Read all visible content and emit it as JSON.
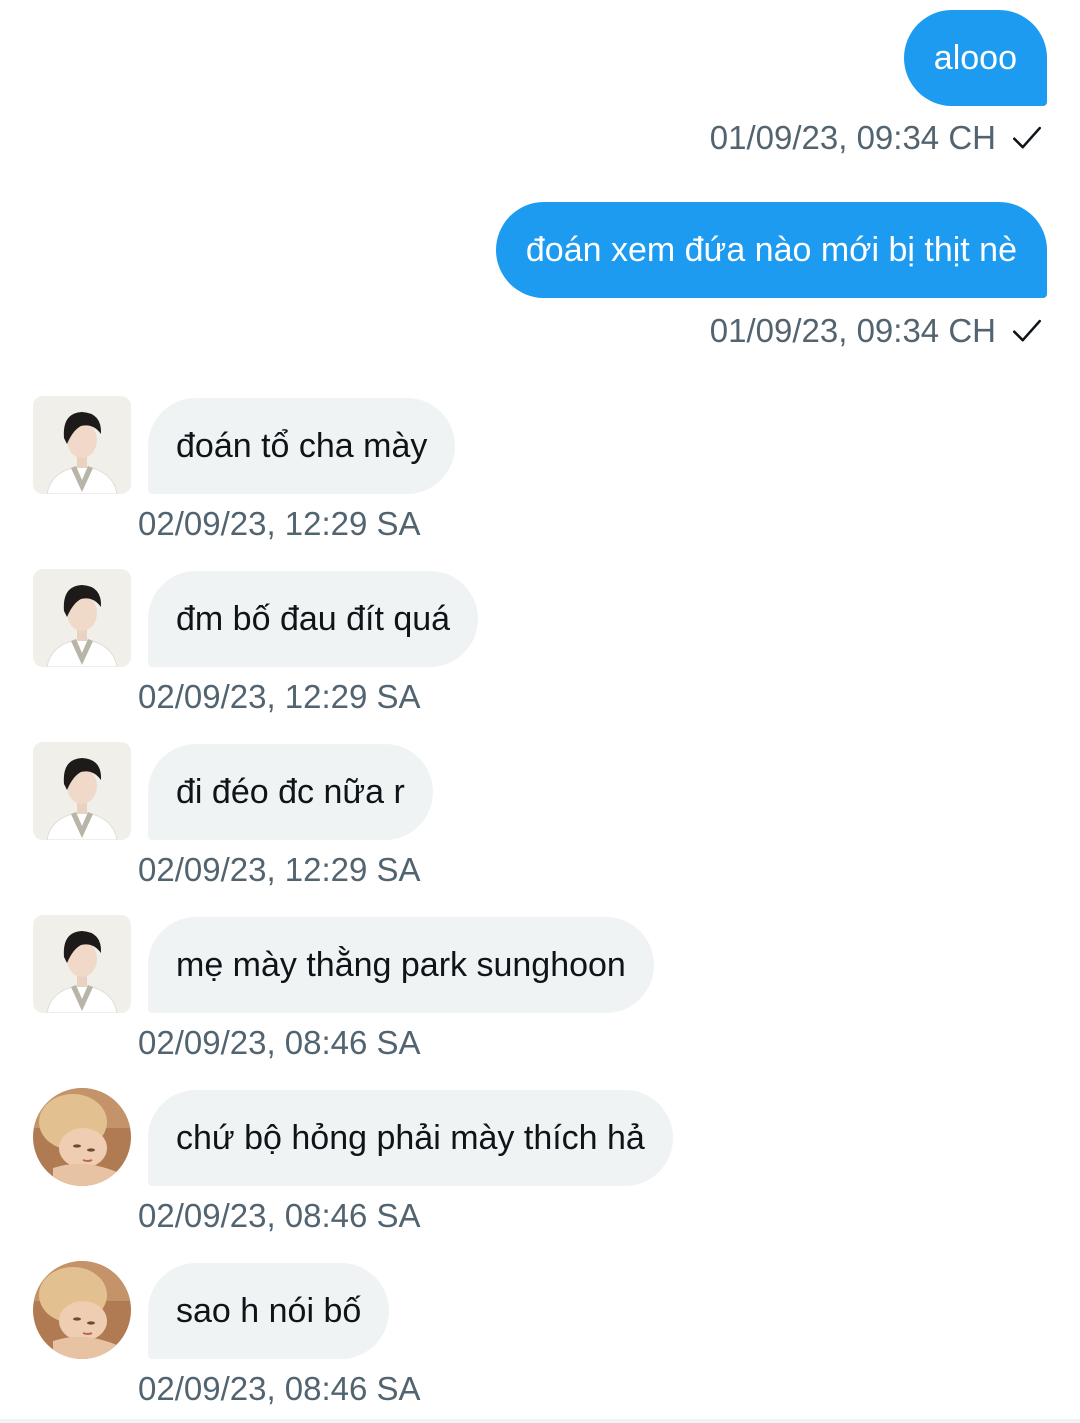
{
  "colors": {
    "sent_bubble": "#1d9bf0",
    "received_bubble": "#eff3f4",
    "timestamp": "#536471"
  },
  "sent_messages": [
    {
      "text": "alooo",
      "time": "01/09/23, 09:34 CH",
      "status_icon": "check-icon"
    },
    {
      "text": "đoán xem đứa nào mới bị thịt nè",
      "time": "01/09/23, 09:34 CH",
      "status_icon": "check-icon"
    }
  ],
  "received_messages": [
    {
      "avatar": "avatar-male-square",
      "text": "đoán tổ cha mày",
      "time": "02/09/23, 12:29 SA"
    },
    {
      "avatar": "avatar-male-square",
      "text": "đm bố đau đít quá",
      "time": "02/09/23, 12:29 SA"
    },
    {
      "avatar": "avatar-male-square",
      "text": "đi đéo đc nữa r",
      "time": "02/09/23, 12:29 SA"
    },
    {
      "avatar": "avatar-male-square",
      "text": "mẹ mày thằng park sunghoon",
      "time": "02/09/23, 08:46 SA"
    },
    {
      "avatar": "avatar-blonde-round",
      "text": "chứ bộ hỏng phải mày thích hả",
      "time": "02/09/23, 08:46 SA"
    },
    {
      "avatar": "avatar-blonde-round",
      "text": "sao h nói bố",
      "time": "02/09/23, 08:46 SA"
    }
  ]
}
